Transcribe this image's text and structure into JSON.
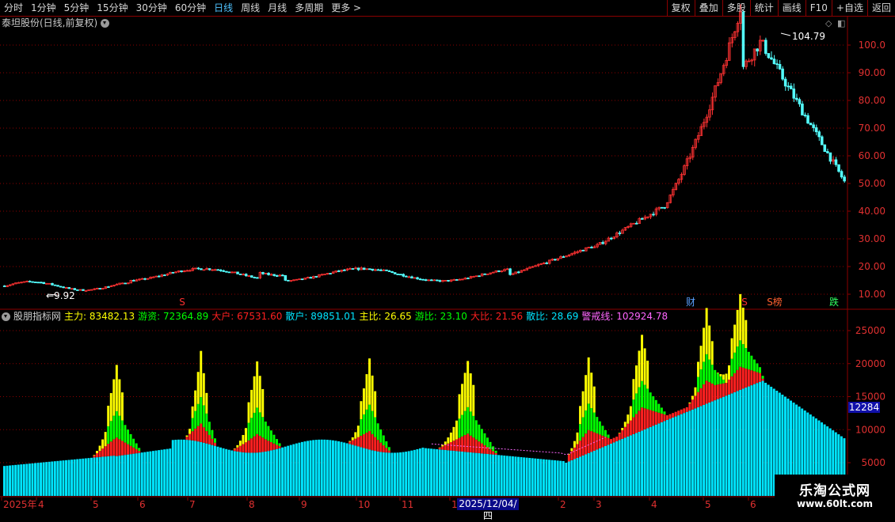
{
  "toolbar": {
    "periods": [
      "分时",
      "1分钟",
      "5分钟",
      "15分钟",
      "30分钟",
      "60分钟",
      "日线",
      "周线",
      "月线",
      "多周期",
      "更多 >"
    ],
    "active_period": "日线",
    "buttons": [
      "复权",
      "叠加",
      "多股",
      "统计",
      "画线",
      "F10",
      "+自选",
      "返回"
    ]
  },
  "chart_title": "泰坦股份(日线,前复权)",
  "price_chart": {
    "y_ticks": [
      "100.0",
      "90.00",
      "80.00",
      "70.00",
      "60.00",
      "50.00",
      "40.00",
      "30.00",
      "20.00",
      "10.00"
    ],
    "high_label": "104.79",
    "low_label": "9.92",
    "markers": [
      {
        "text": "S",
        "color": "#ff3030"
      },
      {
        "text": "财",
        "color": "#5aa0ff"
      },
      {
        "text": "S",
        "color": "#ff3030"
      },
      {
        "text": "S榜",
        "color": "#ff6030"
      },
      {
        "text": "跌",
        "color": "#30ff60"
      }
    ]
  },
  "indicator": {
    "name": "股朋指标网",
    "fields": [
      {
        "label": "主力:",
        "value": "83482.13",
        "color": "#ffff00"
      },
      {
        "label": "游资:",
        "value": "72364.89",
        "color": "#00ff00"
      },
      {
        "label": "大户:",
        "value": "67531.60",
        "color": "#ff2020"
      },
      {
        "label": "散户:",
        "value": "89851.01",
        "color": "#00e5ff"
      },
      {
        "label": "主比:",
        "value": "26.65",
        "color": "#ffff00"
      },
      {
        "label": "游比:",
        "value": "23.10",
        "color": "#00ff00"
      },
      {
        "label": "大比:",
        "value": "21.56",
        "color": "#ff2020"
      },
      {
        "label": "散比:",
        "value": "28.69",
        "color": "#00e5ff"
      },
      {
        "label": "警戒线:",
        "value": "102924.78",
        "color": "#ff66ff"
      }
    ],
    "y_ticks": [
      "25000",
      "20000",
      "15000",
      "10000",
      "5000"
    ],
    "current_value": "12284"
  },
  "x_axis": {
    "labels": [
      "2025年",
      "4",
      "5",
      "6",
      "7",
      "8",
      "9",
      "10",
      "11",
      "1",
      "2",
      "3",
      "4",
      "5",
      "6"
    ],
    "cursor_date": "2025/12/04/四"
  },
  "watermark": {
    "line1": "乐淘公式网",
    "line2": "www.60lt.com"
  },
  "colors": {
    "up": "#ff3232",
    "down": "#54ffff",
    "grid": "#8b0000",
    "zhuli": "#ffff00",
    "youzi": "#00ff00",
    "dahu": "#ff2020",
    "sanhu": "#00e5ff",
    "warn": "#ff66ff"
  }
}
